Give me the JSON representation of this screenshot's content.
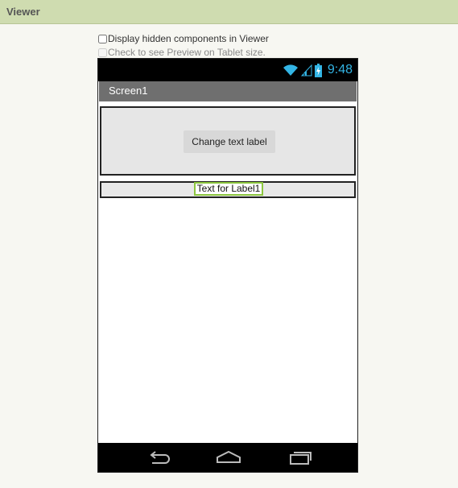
{
  "panel": {
    "title": "Viewer"
  },
  "options": {
    "show_hidden": {
      "label": "Display hidden components in Viewer",
      "checked": false
    },
    "tablet_preview": {
      "label": "Check to see Preview on Tablet size.",
      "checked": false,
      "disabled": true
    }
  },
  "phone": {
    "status_bar": {
      "time": "9:48",
      "icons": [
        "wifi-icon",
        "signal-icon",
        "battery-icon"
      ]
    },
    "screen_title": "Screen1",
    "button": {
      "label": "Change text label"
    },
    "label1": {
      "text": "Text for Label1"
    },
    "nav_icons": [
      "back-icon",
      "home-icon",
      "recent-apps-icon"
    ]
  },
  "colors": {
    "header_bg": "#cfdcb0",
    "status_accent": "#33b5e5",
    "selection_outline": "#8cc63f",
    "titlebar_bg": "#6f6f6f"
  }
}
